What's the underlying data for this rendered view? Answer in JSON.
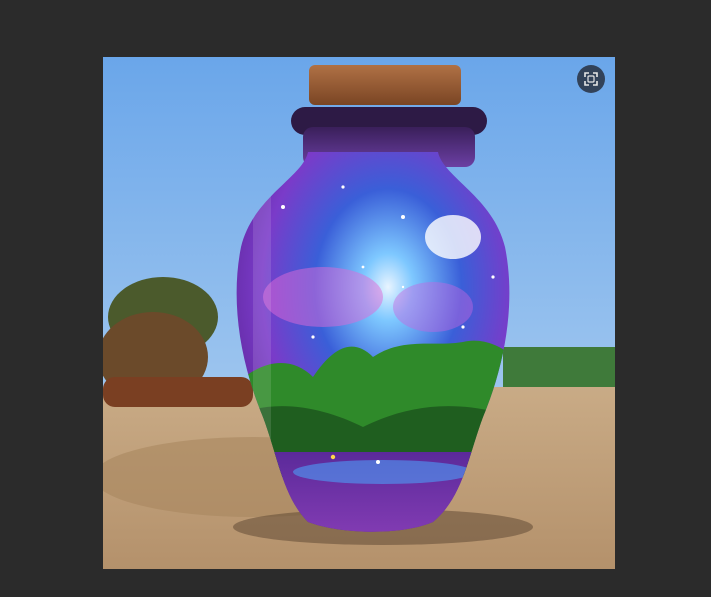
{
  "viewer": {
    "background": "#2b2b2b"
  },
  "image": {
    "icon": "generated-image"
  },
  "controls": {
    "fullscreen_icon": "expand-icon"
  }
}
